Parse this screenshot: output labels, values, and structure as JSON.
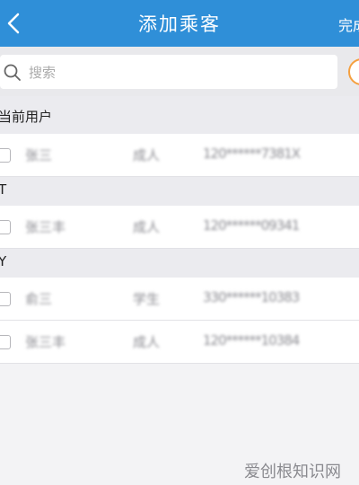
{
  "nav": {
    "title": "添加乘客",
    "done_label": "完成"
  },
  "search": {
    "placeholder": "搜索"
  },
  "sections": [
    {
      "header": "当前用户",
      "rows": [
        {
          "name": "张三",
          "type": "成人",
          "id": "120******7381X"
        }
      ]
    },
    {
      "header": "T",
      "rows": [
        {
          "name": "张三丰",
          "type": "成人",
          "id": "120******09341"
        }
      ]
    },
    {
      "header": "Y",
      "rows": [
        {
          "name": "俞三",
          "type": "学生",
          "id": "330******10383"
        },
        {
          "name": "张三丰",
          "type": "成人",
          "id": "120******10384"
        }
      ]
    }
  ],
  "watermark": "爱创根知识网",
  "colors": {
    "nav_bg": "#2f8fd8",
    "accent_add": "#f5a040",
    "page_bg": "#f3f3f5"
  },
  "icons": {
    "back": "chevron-left-icon",
    "search": "search-icon",
    "add": "add-circle-icon"
  }
}
